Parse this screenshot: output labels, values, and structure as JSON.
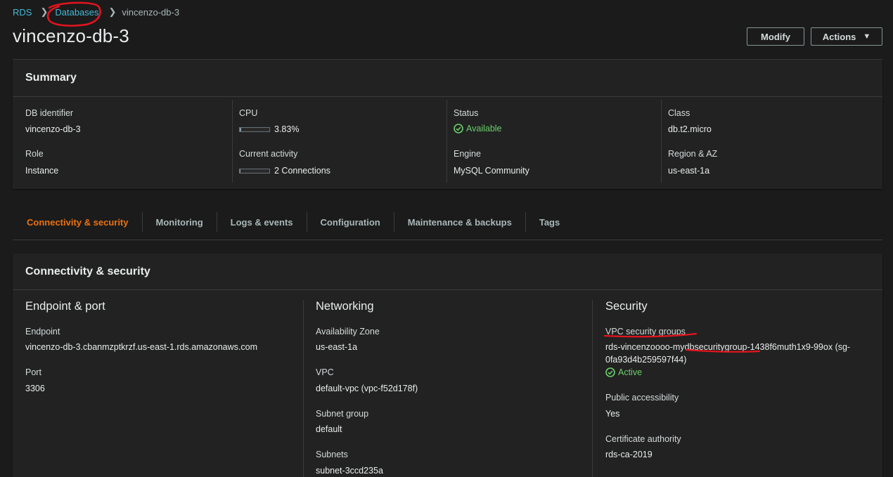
{
  "breadcrumb": {
    "root": "RDS",
    "databases": "Databases",
    "current": "vincenzo-db-3"
  },
  "title": "vincenzo-db-3",
  "buttons": {
    "modify": "Modify",
    "actions": "Actions"
  },
  "summary": {
    "heading": "Summary",
    "db_identifier": {
      "label": "DB identifier",
      "value": "vincenzo-db-3"
    },
    "role": {
      "label": "Role",
      "value": "Instance"
    },
    "cpu": {
      "label": "CPU",
      "value": "3.83%",
      "fraction": 0.0383
    },
    "current_activity": {
      "label": "Current activity",
      "value": "2 Connections",
      "fraction": 0.02
    },
    "status": {
      "label": "Status",
      "value": "Available"
    },
    "engine": {
      "label": "Engine",
      "value": "MySQL Community"
    },
    "class": {
      "label": "Class",
      "value": "db.t2.micro"
    },
    "region": {
      "label": "Region & AZ",
      "value": "us-east-1a"
    }
  },
  "tabs": [
    "Connectivity & security",
    "Monitoring",
    "Logs & events",
    "Configuration",
    "Maintenance & backups",
    "Tags"
  ],
  "connectivity": {
    "heading": "Connectivity & security",
    "endpoint_port": {
      "heading": "Endpoint & port",
      "endpoint_label": "Endpoint",
      "endpoint_value": "vincenzo-db-3.cbanmzptkrzf.us-east-1.rds.amazonaws.com",
      "port_label": "Port",
      "port_value": "3306"
    },
    "networking": {
      "heading": "Networking",
      "az_label": "Availability Zone",
      "az_value": "us-east-1a",
      "vpc_label": "VPC",
      "vpc_value": "default-vpc (vpc-f52d178f)",
      "subnet_group_label": "Subnet group",
      "subnet_group_value": "default",
      "subnets_label": "Subnets",
      "subnets_value": "subnet-3ccd235a"
    },
    "security": {
      "heading": "Security",
      "vpc_sg_label": "VPC security groups",
      "vpc_sg_line1": "rds-vincenzoooo-mydbsecuritygroup-1438f6muth1x9-99ox (sg-",
      "vpc_sg_line2": "0fa93d4b259597f44)",
      "sg_status": "Active",
      "public_label": "Public accessibility",
      "public_value": "Yes",
      "cert_label": "Certificate authority",
      "cert_value": "rds-ca-2019"
    }
  },
  "colors": {
    "accent": "#ec7211",
    "link": "#44b9d6",
    "success": "#6ccf6c",
    "annotation": "#e5141e"
  }
}
